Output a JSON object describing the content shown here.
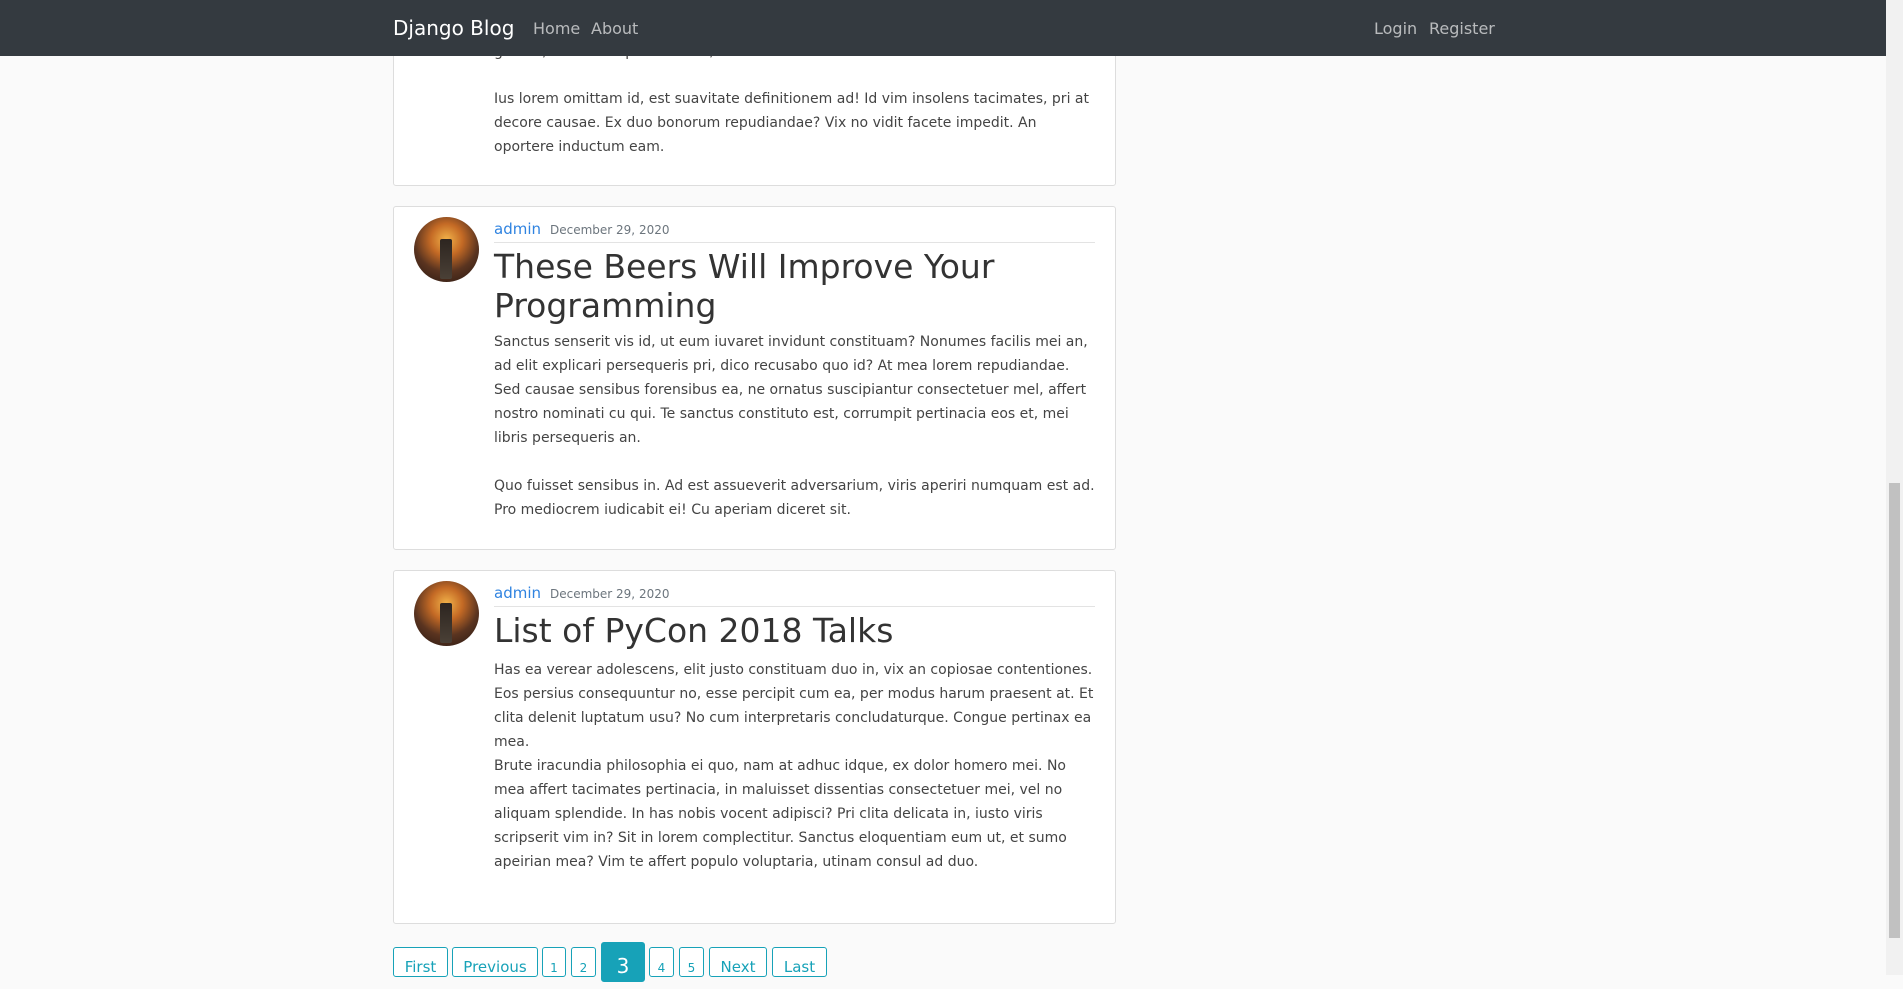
{
  "navbar": {
    "brand": "Django Blog",
    "left_links": [
      "Home",
      "About"
    ],
    "right_links": [
      "Login",
      "Register"
    ]
  },
  "top_post_fragment": {
    "partial_line": "graece, sed debet praesent eu, vim iudim deserunt ut.",
    "paragraph": "Ius lorem omittam id, est suavitate definitionem ad! Id vim insolens tacimates, pri at decore causae. Ex duo bonorum repudiandae? Vix no vidit facete impedit. An oportere inductum eam."
  },
  "posts": [
    {
      "author": "admin",
      "date": "December 29, 2020",
      "title": "These Beers Will Improve Your Programming",
      "paragraphs": [
        "Sanctus senserit vis id, ut eum iuvaret invidunt constituam? Nonumes facilis mei an, ad elit explicari persequeris pri, dico recusabo quo id? At mea lorem repudiandae. Sed causae sensibus forensibus ea, ne ornatus suscipiantur consectetuer mel, affert nostro nominati cu qui. Te sanctus constituto est, corrumpit pertinacia eos et, mei libris persequeris an.",
        "Quo fuisset sensibus in. Ad est assueverit adversarium, viris aperiri numquam est ad. Pro mediocrem iudicabit ei! Cu aperiam diceret sit."
      ]
    },
    {
      "author": "admin",
      "date": "December 29, 2020",
      "title": "List of PyCon 2018 Talks",
      "paragraphs": [
        "Has ea verear adolescens, elit justo constituam duo in, vix an copiosae contentiones. Eos persius consequuntur no, esse percipit cum ea, per modus harum praesent at. Et clita delenit luptatum usu? No cum interpretaris concludaturque. Congue pertinax ea mea.",
        "Brute iracundia philosophia ei quo, nam at adhuc idque, ex dolor homero mei. No mea affert tacimates pertinacia, in maluisset dissentias consectetuer mei, vel no aliquam splendide. In has nobis vocent adipisci? Pri clita delicata in, iusto viris scripserit vim in? Sit in lorem complectitur. Sanctus eloquentiam eum ut, et sumo apeirian mea? Vim te affert populo voluptaria, utinam consul ad duo."
      ]
    }
  ],
  "pagination": {
    "first": "First",
    "previous": "Previous",
    "pages": [
      "1",
      "2",
      "3",
      "4",
      "5"
    ],
    "current": "3",
    "next": "Next",
    "last": "Last"
  },
  "colors": {
    "navbar_bg": "#343a40",
    "link": "#2f83e0",
    "pagination_accent": "#17a2b8"
  }
}
